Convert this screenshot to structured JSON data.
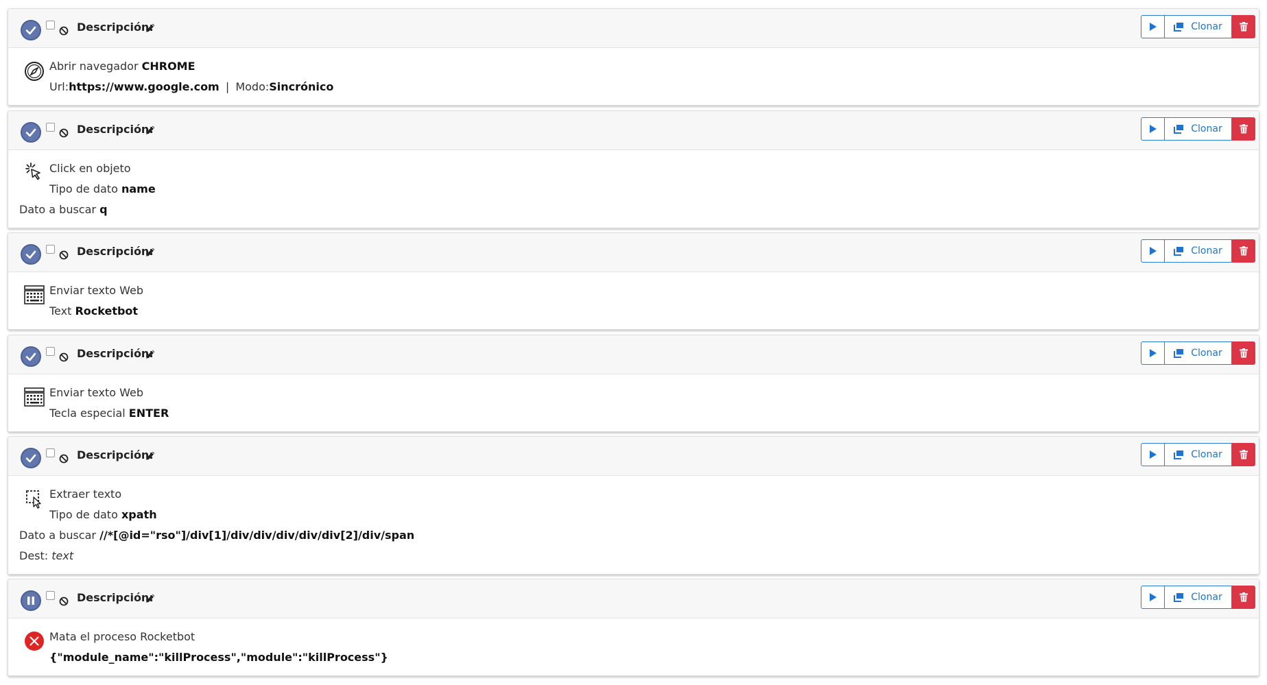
{
  "common": {
    "description_label": "Descripción:",
    "clone_label": "Clonar"
  },
  "colors": {
    "status_active": "#6076ad",
    "accent_blue": "#1e74d0",
    "danger_red": "#dc3545"
  },
  "steps": [
    {
      "status": "check-circle-icon",
      "icon": "compass-icon",
      "title": "Abrir navegador",
      "title_value": "CHROME",
      "url_label": "Url:",
      "url_value": "https://www.google.com",
      "separator": "|",
      "mode_label": "Modo:",
      "mode_value": "Sincrónico"
    },
    {
      "status": "check-circle-icon",
      "icon": "click-pointer-icon",
      "title": "Click en objeto",
      "type_label": "Tipo de dato",
      "type_value": "name",
      "search_label": "Dato a buscar",
      "search_value": "q"
    },
    {
      "status": "check-circle-icon",
      "icon": "keyboard-icon",
      "title": "Enviar texto Web",
      "text_label": "Text",
      "text_value": "Rocketbot"
    },
    {
      "status": "check-circle-icon",
      "icon": "keyboard-icon",
      "title": "Enviar texto Web",
      "key_label": "Tecla especial",
      "key_value": "ENTER"
    },
    {
      "status": "check-circle-icon",
      "icon": "select-area-icon",
      "title": "Extraer texto",
      "type_label": "Tipo de dato",
      "type_value": "xpath",
      "search_label": "Dato a buscar",
      "search_value": "//*[@id=\"rso\"]/div[1]/div/div/div/div/div[2]/div/span",
      "dest_label": "Dest:",
      "dest_value": "text"
    },
    {
      "status": "pause-circle-icon",
      "icon": "error-x-icon",
      "title": "Mata el proceso Rocketbot",
      "json_value": "{\"module_name\":\"killProcess\",\"module\":\"killProcess\"}"
    }
  ]
}
